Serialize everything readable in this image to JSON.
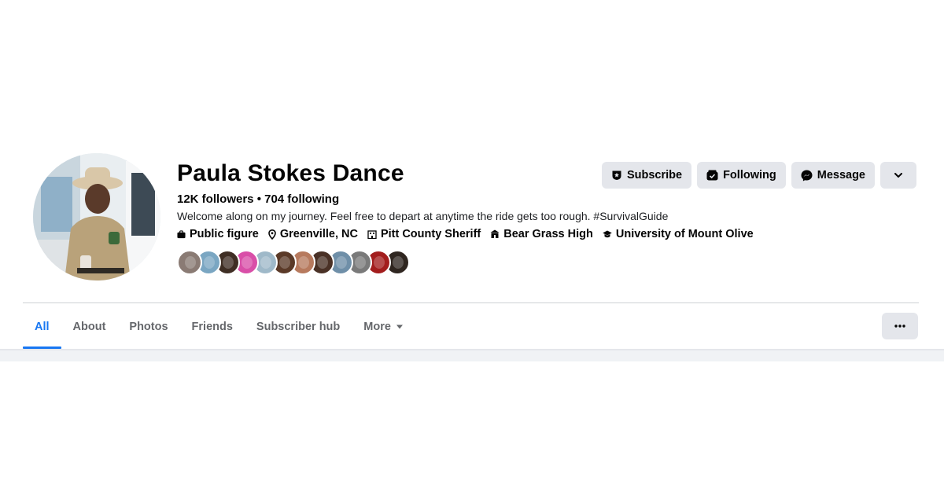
{
  "profile": {
    "name": "Paula Stokes Dance",
    "counts": "12K followers • 704 following",
    "bio": "Welcome along on my journey. Feel free to depart at anytime the ride gets too rough. #SurvivalGuide",
    "intro": [
      {
        "icon": "briefcase-icon",
        "label": "Public figure"
      },
      {
        "icon": "location-pin-icon",
        "label": "Greenville, NC"
      },
      {
        "icon": "building-icon",
        "label": "Pitt County Sheriff"
      },
      {
        "icon": "school-icon",
        "label": "Bear Grass High"
      },
      {
        "icon": "graduation-cap-icon",
        "label": "University of Mount Olive"
      }
    ],
    "friend_avatars": [
      {
        "color": "#8a7b74"
      },
      {
        "color": "#7aa6c2"
      },
      {
        "color": "#3f2e24"
      },
      {
        "color": "#d94fa8"
      },
      {
        "color": "#9fb9c9"
      },
      {
        "color": "#5b3a28"
      },
      {
        "color": "#b77a5e"
      },
      {
        "color": "#4a3126"
      },
      {
        "color": "#6f8fa8"
      },
      {
        "color": "#7a7a7a"
      },
      {
        "color": "#a31d1d"
      },
      {
        "color": "#2f2620"
      }
    ]
  },
  "actions": {
    "subscribe_label": "Subscribe",
    "following_label": "Following",
    "message_label": "Message",
    "dropdown_icon": "chevron-down-icon"
  },
  "tabs": [
    {
      "label": "All",
      "active": true
    },
    {
      "label": "About",
      "active": false
    },
    {
      "label": "Photos",
      "active": false
    },
    {
      "label": "Friends",
      "active": false
    },
    {
      "label": "Subscriber hub",
      "active": false
    },
    {
      "label": "More",
      "active": false
    }
  ],
  "colors": {
    "accent": "#1877f2",
    "button_bg": "#e4e6eb",
    "secondary_text": "#65676b"
  }
}
